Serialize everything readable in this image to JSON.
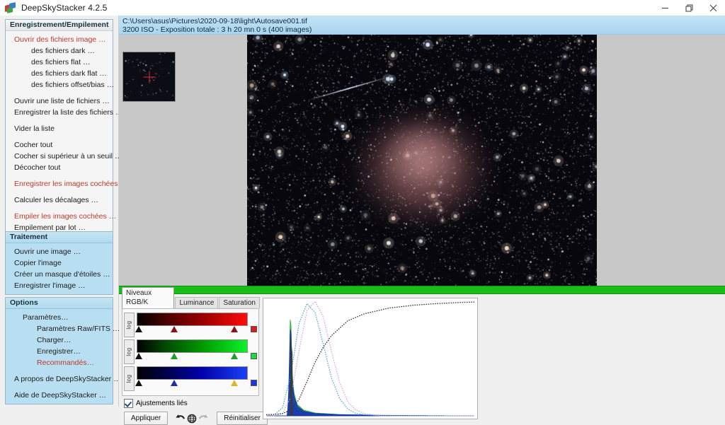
{
  "window": {
    "title": "DeepSkyStacker 4.2.5",
    "icon": "deepskystacker-logo",
    "minimize_label": "minimize-icon",
    "restore_label": "restore-icon",
    "close_label": "close-icon"
  },
  "sidebar": {
    "panels": [
      {
        "id": "registering-stacking",
        "title": "Enregistrement/Empilement",
        "style": "grey",
        "items": [
          {
            "label": "Ouvrir des fichiers image …",
            "color": "red",
            "indent": 0
          },
          {
            "label": "des fichiers dark …",
            "color": "black",
            "indent": 1
          },
          {
            "label": "des fichiers flat …",
            "color": "black",
            "indent": 1
          },
          {
            "label": "des fichiers dark flat …",
            "color": "black",
            "indent": 1
          },
          {
            "label": "des fichiers offset/bias …",
            "color": "black",
            "indent": 1
          },
          {
            "label": "__gap__",
            "color": "gap",
            "indent": 0
          },
          {
            "label": "Ouvrir une liste de fichiers …",
            "color": "black",
            "indent": 0
          },
          {
            "label": "Enregistrer la liste des fichiers …",
            "color": "black",
            "indent": 0
          },
          {
            "label": "__gap__",
            "color": "gap",
            "indent": 0
          },
          {
            "label": "Vider la liste",
            "color": "black",
            "indent": 0
          },
          {
            "label": "__gap__",
            "color": "gap",
            "indent": 0
          },
          {
            "label": "Cocher tout",
            "color": "black",
            "indent": 0
          },
          {
            "label": "Cocher si supérieur à un seuil …",
            "color": "black",
            "indent": 0
          },
          {
            "label": "Décocher tout",
            "color": "black",
            "indent": 0
          },
          {
            "label": "__gap__",
            "color": "gap",
            "indent": 0
          },
          {
            "label": "Enregistrer les images cochées …",
            "color": "red",
            "indent": 0
          },
          {
            "label": "__gap__",
            "color": "gap",
            "indent": 0
          },
          {
            "label": "Calculer les décalages …",
            "color": "black",
            "indent": 0
          },
          {
            "label": "__gap__",
            "color": "gap",
            "indent": 0
          },
          {
            "label": "Empiler les images cochées …",
            "color": "red",
            "indent": 0
          },
          {
            "label": "Empilement par lot …",
            "color": "black",
            "indent": 0
          }
        ]
      },
      {
        "id": "processing",
        "title": "Traitement",
        "style": "blue",
        "items": [
          {
            "label": "Ouvrir une image …",
            "color": "black",
            "indent": 0
          },
          {
            "label": "Copier l'image",
            "color": "black",
            "indent": 0
          },
          {
            "label": "Créer un masque d'étoiles …",
            "color": "black",
            "indent": 0
          },
          {
            "label": "Enregistrer l'image …",
            "color": "black",
            "indent": 0
          }
        ]
      },
      {
        "id": "options",
        "title": "Options",
        "style": "blue",
        "items": [
          {
            "label": "Paramètres…",
            "color": "black",
            "indent": 1
          },
          {
            "label": "Paramètres Raw/FITS …",
            "color": "black",
            "indent": 2
          },
          {
            "label": "Charger…",
            "color": "black",
            "indent": 2
          },
          {
            "label": "Enregistrer…",
            "color": "black",
            "indent": 2
          },
          {
            "label": "Recommandés…",
            "color": "red",
            "indent": 2
          },
          {
            "label": "__gap__",
            "color": "gap",
            "indent": 0
          },
          {
            "label": "A propos de DeepSkyStacker …",
            "color": "black",
            "indent": 0
          },
          {
            "label": "__gap__",
            "color": "gap",
            "indent": 0
          },
          {
            "label": "Aide de DeepSkyStacker …",
            "color": "black",
            "indent": 0
          }
        ]
      }
    ]
  },
  "infobar": {
    "path": "C:\\Users\\asus\\Pictures\\2020-09-18\\light\\Autosave001.tif",
    "details": "3200 ISO - Exposition totale : 3 h 20 mn 0 s (400 images)"
  },
  "viewer": {
    "thumbnail_name": "navigation-thumbnail",
    "image_name": "stacked-astro-image",
    "progress_bar_color": "#18bd18"
  },
  "levels": {
    "tabs": [
      {
        "label": "Niveaux RGB/K",
        "active": true
      },
      {
        "label": "Luminance",
        "active": false
      },
      {
        "label": "Saturation",
        "active": false
      }
    ],
    "log_label": "log",
    "channels": [
      {
        "name": "red",
        "log_label": "log",
        "markers": [
          2,
          34,
          88
        ],
        "selected_marker": -1,
        "chip": "#e11b1b"
      },
      {
        "name": "green",
        "log_label": "log",
        "markers": [
          2,
          34,
          88
        ],
        "selected_marker": -1,
        "chip": "#1ddb3b"
      },
      {
        "name": "blue",
        "log_label": "log",
        "markers": [
          2,
          34,
          88
        ],
        "selected_marker": 2,
        "chip": "#1b35e1"
      }
    ],
    "linked_checkbox": {
      "label": "Ajustements liés",
      "checked": true
    },
    "buttons": {
      "apply": "Appliquer",
      "undo": "undo-icon",
      "settings": "globe-icon",
      "redo": "redo-icon",
      "reset": "Réinitialiser"
    }
  },
  "histogram": {
    "name": "levels-histogram",
    "grid": false,
    "legend": "none"
  },
  "chart_data": {
    "type": "line",
    "title": "",
    "xlabel": "",
    "ylabel": "",
    "xlim": [
      0,
      255
    ],
    "ylim": [
      0,
      1
    ],
    "grid": false,
    "series": [
      {
        "name": "red-histogram",
        "color": "#e01010",
        "style": "filled-spike",
        "x": [
          26,
          28,
          29,
          30,
          31,
          32,
          33,
          34,
          36,
          38,
          42,
          48,
          56,
          70,
          90,
          120,
          160,
          200,
          255
        ],
        "values": [
          0.0,
          0.05,
          0.28,
          0.45,
          0.3,
          0.18,
          0.12,
          0.09,
          0.07,
          0.055,
          0.04,
          0.03,
          0.022,
          0.015,
          0.01,
          0.006,
          0.003,
          0.001,
          0.0
        ]
      },
      {
        "name": "green-histogram",
        "color": "#12b12a",
        "style": "filled-spike",
        "x": [
          26,
          28,
          29,
          30,
          31,
          32,
          34,
          38,
          46,
          60,
          90,
          140,
          200,
          255
        ],
        "values": [
          0.0,
          0.3,
          0.78,
          0.92,
          0.6,
          0.35,
          0.2,
          0.1,
          0.05,
          0.025,
          0.012,
          0.005,
          0.002,
          0.0
        ]
      },
      {
        "name": "blue-histogram",
        "color": "#1526c8",
        "style": "filled-spike",
        "x": [
          26,
          28,
          29,
          30,
          31,
          32,
          34,
          38,
          46,
          60,
          90,
          140,
          200,
          255
        ],
        "values": [
          0.0,
          0.25,
          0.68,
          0.86,
          0.52,
          0.3,
          0.17,
          0.085,
          0.04,
          0.02,
          0.01,
          0.004,
          0.002,
          0.0
        ]
      },
      {
        "name": "target-curve-left",
        "color": "#3aa0c8",
        "style": "dotted-bell",
        "x": [
          0,
          10,
          20,
          30,
          40,
          50,
          60,
          70,
          80,
          90,
          100,
          110,
          120,
          140,
          180,
          255
        ],
        "values": [
          0.0,
          0.01,
          0.07,
          0.35,
          0.8,
          0.98,
          0.9,
          0.62,
          0.33,
          0.15,
          0.06,
          0.02,
          0.01,
          0.0,
          0.0,
          0.0
        ]
      },
      {
        "name": "target-curve-right",
        "color": "#d89ad0",
        "style": "dotted-bell",
        "x": [
          0,
          10,
          20,
          30,
          40,
          50,
          60,
          70,
          80,
          90,
          100,
          110,
          120,
          140,
          180,
          255
        ],
        "values": [
          0.0,
          0.0,
          0.02,
          0.16,
          0.56,
          0.92,
          1.0,
          0.86,
          0.56,
          0.29,
          0.12,
          0.05,
          0.02,
          0.0,
          0.0,
          0.0
        ]
      },
      {
        "name": "tone-transfer-curve",
        "color": "#333333",
        "style": "dotted-line",
        "x": [
          0,
          10,
          20,
          30,
          40,
          50,
          60,
          70,
          80,
          100,
          120,
          150,
          180,
          210,
          240,
          255
        ],
        "values": [
          0.01,
          0.012,
          0.02,
          0.05,
          0.14,
          0.3,
          0.47,
          0.6,
          0.7,
          0.83,
          0.89,
          0.94,
          0.965,
          0.98,
          0.99,
          0.993
        ]
      }
    ]
  }
}
